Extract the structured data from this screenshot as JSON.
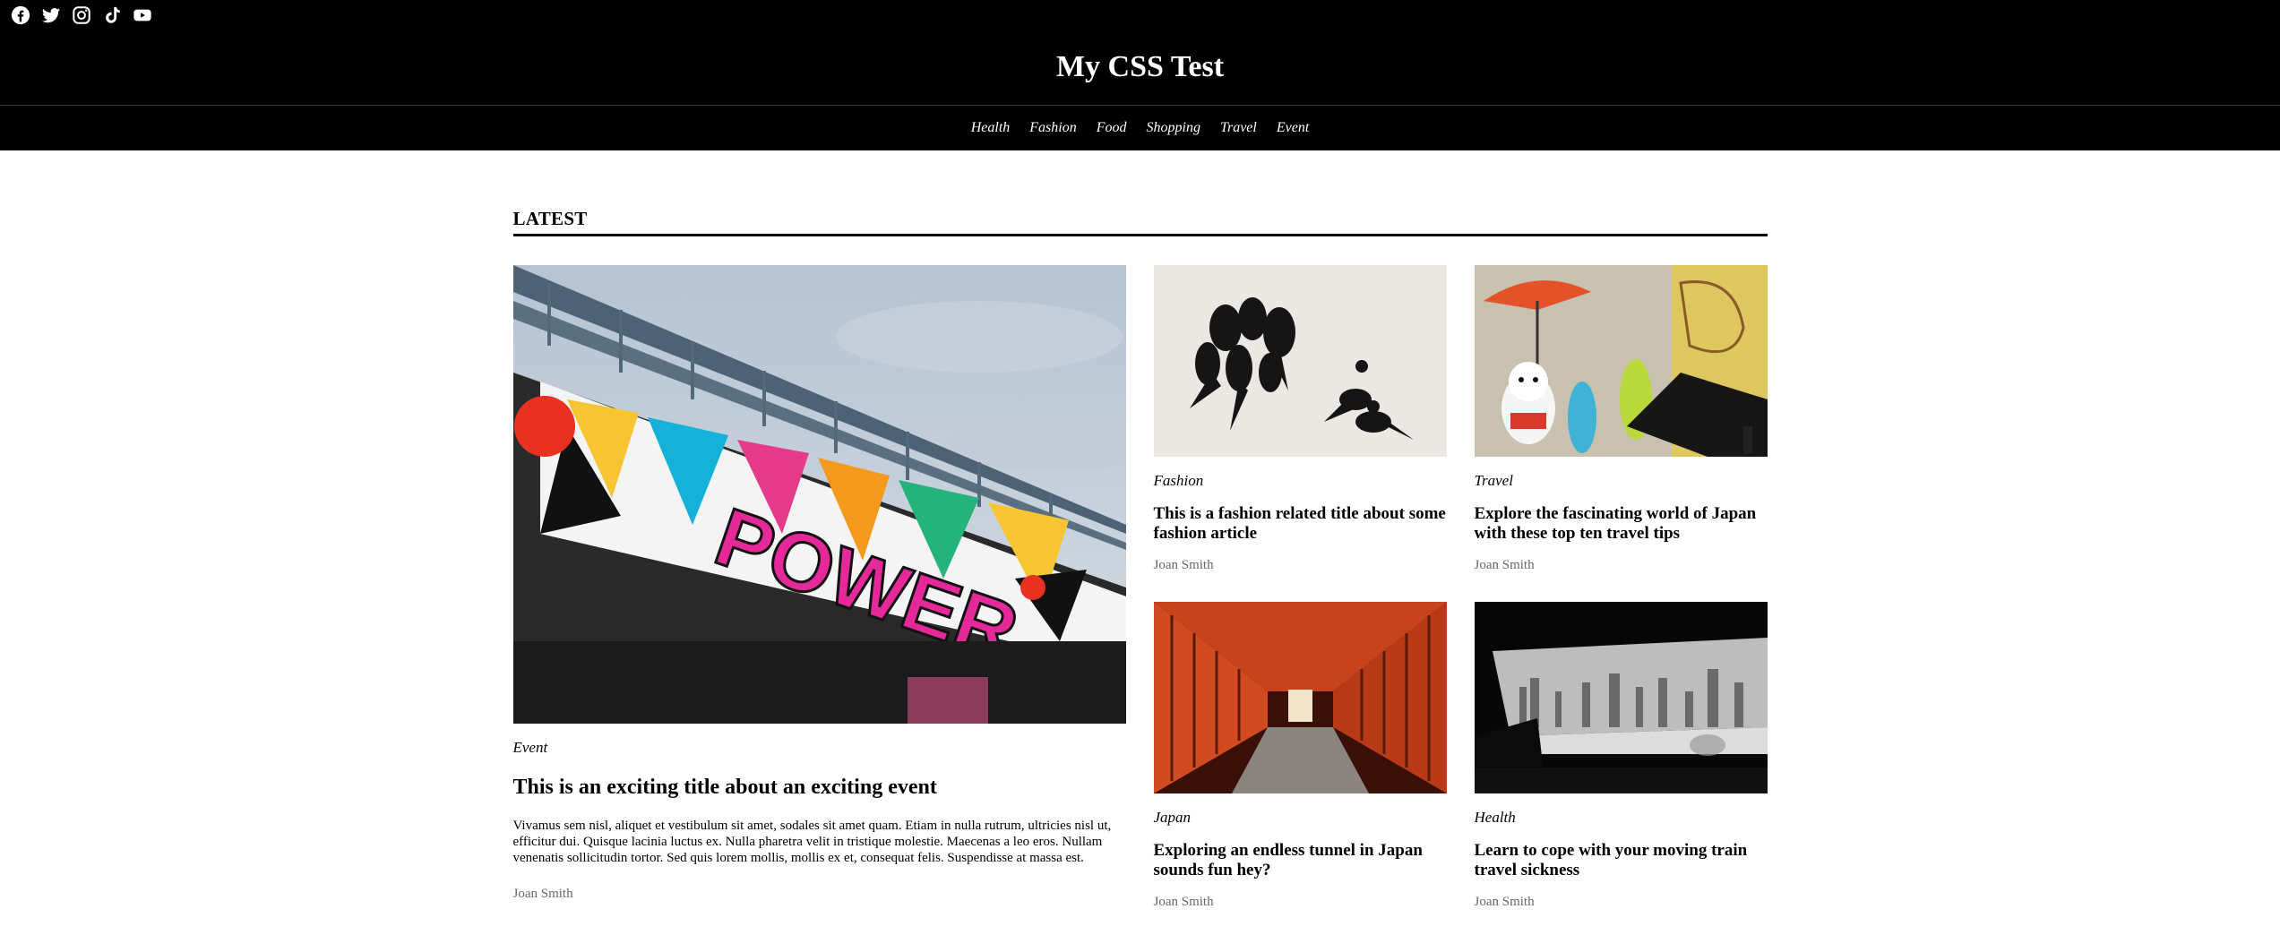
{
  "header": {
    "social_icons": [
      "facebook-icon",
      "twitter-icon",
      "instagram-icon",
      "tiktok-icon",
      "youtube-icon"
    ],
    "site_title": "My CSS Test"
  },
  "nav": {
    "items": [
      "Health",
      "Fashion",
      "Food",
      "Shopping",
      "Travel",
      "Event"
    ]
  },
  "latest": {
    "heading": "LATEST",
    "feature": {
      "category": "Event",
      "title": "This is an exciting title about an exciting event",
      "excerpt": "Vivamus sem nisl, aliquet et vestibulum sit amet, sodales sit amet quam. Etiam in nulla rutrum, ultricies nisl ut, efficitur dui. Quisque lacinia luctus ex. Nulla pharetra velit in tristique molestie. Maecenas a leo eros. Nullam venenatis sollicitudin tortor. Sed quis lorem mollis, mollis ex et, consequat felis. Suspendisse at massa est.",
      "author": "Joan Smith",
      "image_text": "POWER"
    },
    "cards": [
      {
        "category": "Fashion",
        "title": "This is a fashion related title about some fashion article",
        "author": "Joan Smith"
      },
      {
        "category": "Travel",
        "title": "Explore the fascinating world of Japan with these top ten travel tips",
        "author": "Joan Smith"
      },
      {
        "category": "Japan",
        "title": "Exploring an endless tunnel in Japan sounds fun hey?",
        "author": "Joan Smith"
      },
      {
        "category": "Health",
        "title": "Learn to cope with your moving train travel sickness",
        "author": "Joan Smith"
      }
    ]
  }
}
